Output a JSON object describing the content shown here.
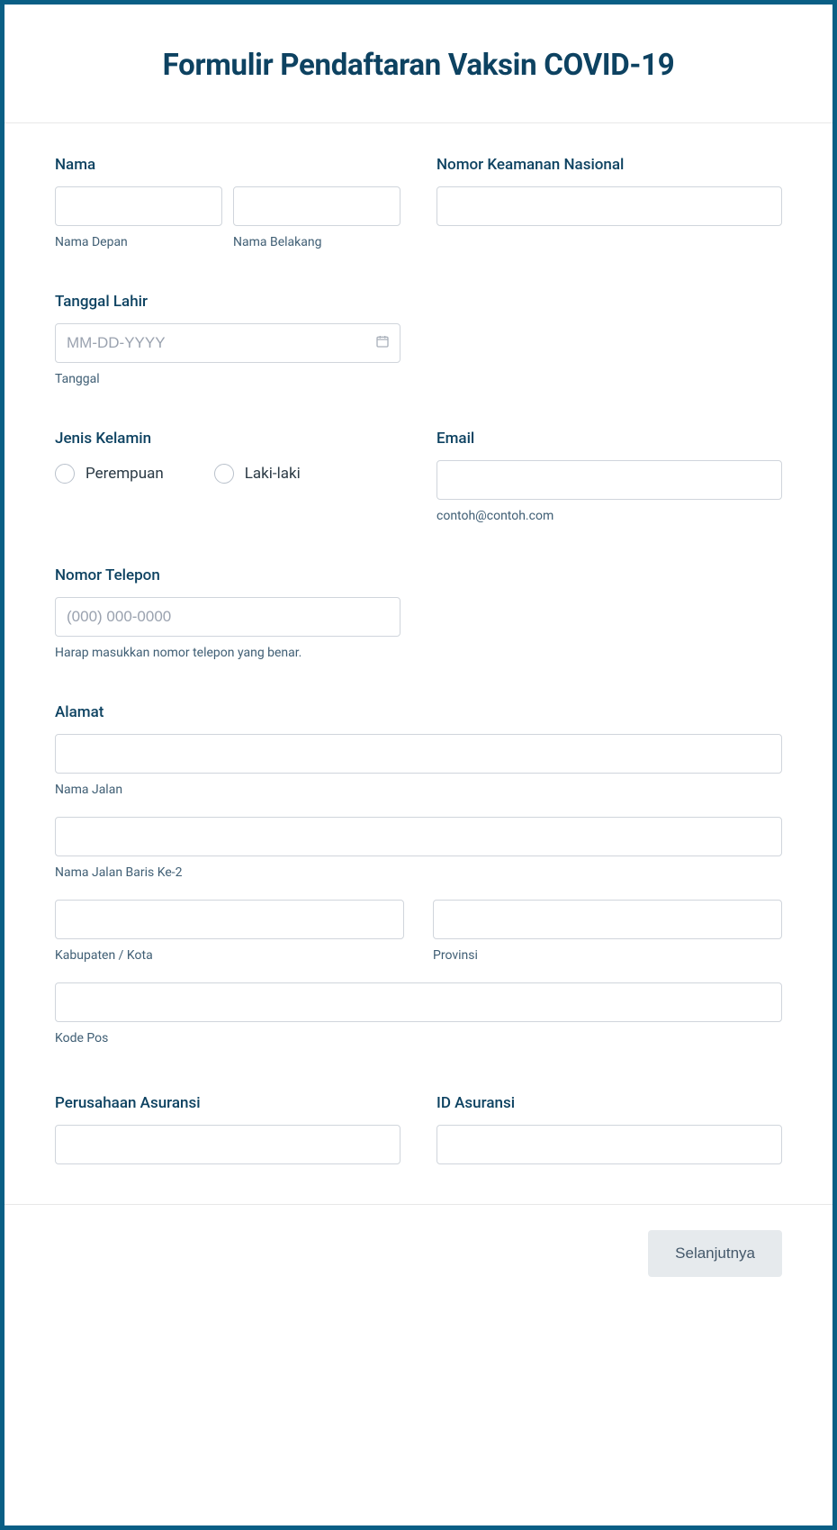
{
  "title": "Formulir Pendaftaran Vaksin COVID-19",
  "fields": {
    "name": {
      "label": "Nama",
      "first_sub": "Nama Depan",
      "last_sub": "Nama Belakang"
    },
    "ssn": {
      "label": "Nomor Keamanan Nasional"
    },
    "dob": {
      "label": "Tanggal Lahir",
      "placeholder": "MM-DD-YYYY",
      "sub": "Tanggal"
    },
    "gender": {
      "label": "Jenis Kelamin",
      "options": {
        "female": "Perempuan",
        "male": "Laki-laki"
      }
    },
    "email": {
      "label": "Email",
      "sub": "contoh@contoh.com"
    },
    "phone": {
      "label": "Nomor Telepon",
      "placeholder": "(000) 000-0000",
      "sub": "Harap masukkan nomor telepon yang benar."
    },
    "address": {
      "label": "Alamat",
      "street1_sub": "Nama Jalan",
      "street2_sub": "Nama Jalan Baris Ke-2",
      "city_sub": "Kabupaten / Kota",
      "province_sub": "Provinsi",
      "postal_sub": "Kode Pos"
    },
    "insurance_company": {
      "label": "Perusahaan Asuransi"
    },
    "insurance_id": {
      "label": "ID Asuransi"
    }
  },
  "buttons": {
    "next": "Selanjutnya"
  }
}
